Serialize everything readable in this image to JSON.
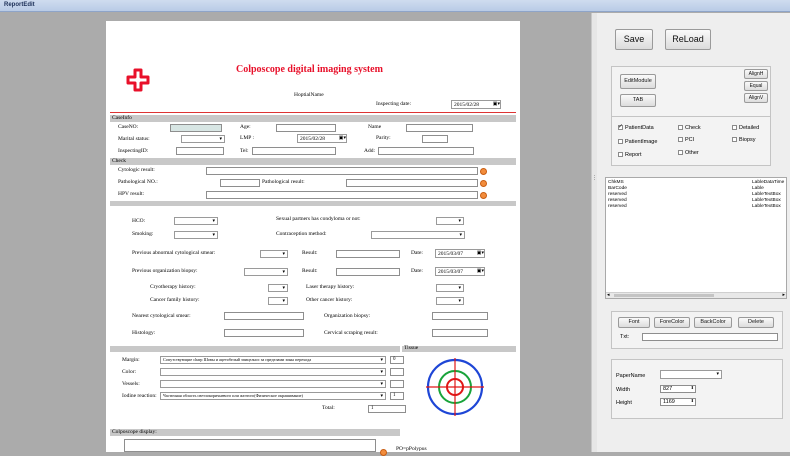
{
  "window": {
    "title": "ReportEdit"
  },
  "report": {
    "title": "Colposcope digital imaging system",
    "hospital": "HoptialName",
    "inspect_label": "Inspecting date:",
    "inspect_date": "2015/02/28",
    "caseinfo": {
      "header": "CaseInfo",
      "caseno": "CaseNO:",
      "age": "Age:",
      "name": "Name",
      "marital": "Marital status:",
      "lmp": "LMP :",
      "lmp_date": "2015/02/28",
      "parity": "Parity:",
      "inspecting_id": "InspectingID:",
      "tel": "Tel:",
      "add": "Add:"
    },
    "check": {
      "header": "Check",
      "cytologic": "Cytologic result:",
      "pathological_no": "Pathological NO.:",
      "pathological_result": "Pathological  result:",
      "hpv": "HPV result:"
    },
    "history": {
      "hco": "HCO:",
      "sexual": "Sexual partners has condyloma or not:",
      "smoking": "Smoking:",
      "contraception": "Contraception method:",
      "prev_smear": "Previous abnormal cytological smear:",
      "result": "Result:",
      "date": "Date:",
      "date1": "2015/03/07",
      "prev_biopsy": "Previous organization biopsy:",
      "date2": "2015/03/07",
      "cryo": "Cryotherapy history:",
      "laser": "Laser therapy history:",
      "cancer_family": "Cancer family history:",
      "other_cancer": "Other cancer history:",
      "nearest_smear": "Nearest cytological smear:",
      "org_biopsy": "Organization biopsy:",
      "histology": "Histology:",
      "cervical": "Cervical scraping result:"
    },
    "tissue": {
      "header": "Tissue",
      "margin": "Margin:",
      "margin_value": "Сопутствующие сharp Шовы и ацетобелый эпицелнос за пределами зоны перехода",
      "margin_score": "0",
      "color": "Color:",
      "vessels": "Vessels:",
      "iodine": "Iodine reaction:",
      "iodine_value": "Частичная область светлокоричневого или желтого(Физическое окрашивание)",
      "iodine_score": "1",
      "total": "Total:",
      "total_value": "1"
    },
    "display": {
      "header": "Colposcope display:",
      "po": "PO=pPolypus"
    }
  },
  "panel": {
    "save": "Save",
    "reload": "ReLoad",
    "editmodule": "EditModule",
    "tab": "TAB",
    "alignh": "AlignH",
    "equal": "Equal",
    "alignv": "AlignV",
    "checks": [
      {
        "label": "PatientData",
        "checked": true
      },
      {
        "label": "Check",
        "checked": false
      },
      {
        "label": "Detailed",
        "checked": false
      },
      {
        "label": "PatientImage",
        "checked": false
      },
      {
        "label": "PCI",
        "checked": false
      },
      {
        "label": "Biopsy",
        "checked": false
      },
      {
        "label": "Report",
        "checked": false
      },
      {
        "label": "Other",
        "checked": false
      }
    ],
    "list": [
      {
        "name": "ChkMS",
        "type": "LableDataTime"
      },
      {
        "name": "BarCode",
        "type": "Lable"
      },
      {
        "name": "reserved",
        "type": "LableTextBox"
      },
      {
        "name": "reserved",
        "type": "LableTextBox"
      },
      {
        "name": "reserved",
        "type": "LableTextBox"
      }
    ],
    "font": "Font",
    "forecolor": "ForeColor",
    "backcolor": "BackColor",
    "delete": "Delete",
    "txt": "Txt:",
    "papername": "PaperName",
    "width_label": "Width",
    "width_value": "827",
    "height_label": "Height",
    "height_value": "1169"
  },
  "colors": {
    "accent_red": "#e8102a",
    "orange_btn": "#f28c3c"
  }
}
